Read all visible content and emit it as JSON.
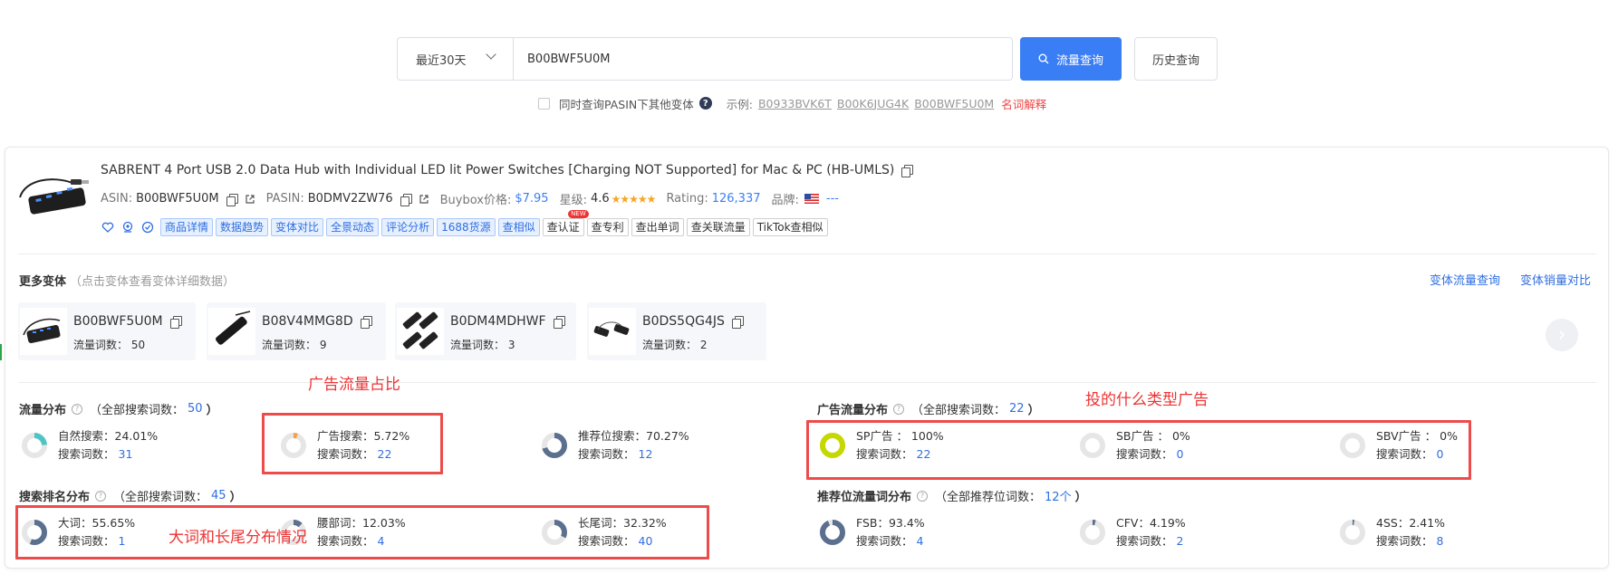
{
  "search": {
    "range": "最近30天",
    "asin_value": "B00BWF5U0M",
    "query_button": "流量查询",
    "history_button": "历史查询"
  },
  "options": {
    "checkbox_label": "同时查询PASIN下其他变体",
    "example_label": "示例:",
    "examples": [
      "B0933BVK6T",
      "B00K6JUG4K",
      "B00BWF5U0M"
    ],
    "glossary": "名词解释"
  },
  "product": {
    "title": "SABRENT 4 Port USB 2.0 Data Hub with Individual LED lit Power Switches [Charging NOT Supported] for Mac & PC (HB-UMLS)",
    "asin_label": "ASIN:",
    "asin": "B00BWF5U0M",
    "pasin_label": "PASIN:",
    "pasin": "B0DMV2ZW76",
    "buybox_label": "Buybox价格:",
    "buybox_price": "$7.95",
    "rating_stars_label": "星级:",
    "rating_stars": "4.6",
    "rating_label": "Rating:",
    "rating_count": "126,337",
    "brand_label": "品牌:",
    "brand_value": "---",
    "tags_blue": [
      "商品详情",
      "数据趋势",
      "变体对比",
      "全景动态",
      "评论分析",
      "1688货源",
      "查相似"
    ],
    "tags_plain": [
      "查认证",
      "查专利",
      "查出单词",
      "查关联流量",
      "TikTok查相似"
    ],
    "new_badge": "NEW"
  },
  "variants": {
    "title": "更多变体",
    "hint": "（点击变体查看变体详细数据）",
    "link_traffic": "变体流量查询",
    "link_sales": "变体销量对比",
    "count_label": "流量词数：",
    "items": [
      {
        "asin": "B00BWF5U0M",
        "count": "50"
      },
      {
        "asin": "B08V4MMG8D",
        "count": "9"
      },
      {
        "asin": "B0DM4MDHWF",
        "count": "3"
      },
      {
        "asin": "B0DS5QG4JS",
        "count": "2"
      }
    ]
  },
  "traffic": {
    "title": "流量分布",
    "sub_prefix": "（全部搜索词数：",
    "total": "50",
    "sub_suffix": "）",
    "search_count_label": "搜索词数：",
    "items": [
      {
        "label": "自然搜索：24.01%",
        "count": "31",
        "percent": 24.01,
        "color": "#4fc4c4"
      },
      {
        "label": "广告搜索：5.72%",
        "count": "22",
        "percent": 5.72,
        "color": "#f5a04a"
      },
      {
        "label": "推荐位搜索：70.27%",
        "count": "12",
        "percent": 70.27,
        "color": "#5b6f8f"
      }
    ]
  },
  "ad_traffic": {
    "title": "广告流量分布",
    "sub_prefix": "（全部搜索词数：",
    "total": "22",
    "sub_suffix": "）",
    "items": [
      {
        "label": "SP广告 ： 100%",
        "count": "22",
        "percent": 100,
        "color": "#c5d800"
      },
      {
        "label": "SB广告 ： 0%",
        "count": "0",
        "percent": 0,
        "color": "#c5d800"
      },
      {
        "label": "SBV广告 ： 0%",
        "count": "0",
        "percent": 0,
        "color": "#c5d800"
      }
    ]
  },
  "rank": {
    "title": "搜索排名分布",
    "sub_prefix": "（全部搜索词数：",
    "total": "45",
    "sub_suffix": "）",
    "items": [
      {
        "label": "大词：55.65%",
        "count": "1",
        "percent": 55.65,
        "color": "#5b6f8f"
      },
      {
        "label": "腰部词：12.03%",
        "count": "4",
        "percent": 12.03,
        "color": "#5b6f8f"
      },
      {
        "label": "长尾词：32.32%",
        "count": "40",
        "percent": 32.32,
        "color": "#5b6f8f"
      }
    ]
  },
  "rec": {
    "title": "推荐位流量词分布",
    "sub_prefix": "（全部推荐位词数：",
    "total": "12个",
    "sub_suffix": "）",
    "items": [
      {
        "label": "FSB：93.4%",
        "count": "4",
        "percent": 93.4,
        "color": "#5b6f8f"
      },
      {
        "label": "CFV：4.19%",
        "count": "2",
        "percent": 4.19,
        "color": "#5b6f8f"
      },
      {
        "label": "4SS：2.41%",
        "count": "8",
        "percent": 2.41,
        "color": "#5b6f8f"
      }
    ]
  },
  "annotations": {
    "ad_share": "广告流量占比",
    "ad_type": "投的什么类型广告",
    "big_long": "大词和长尾分布情况"
  }
}
